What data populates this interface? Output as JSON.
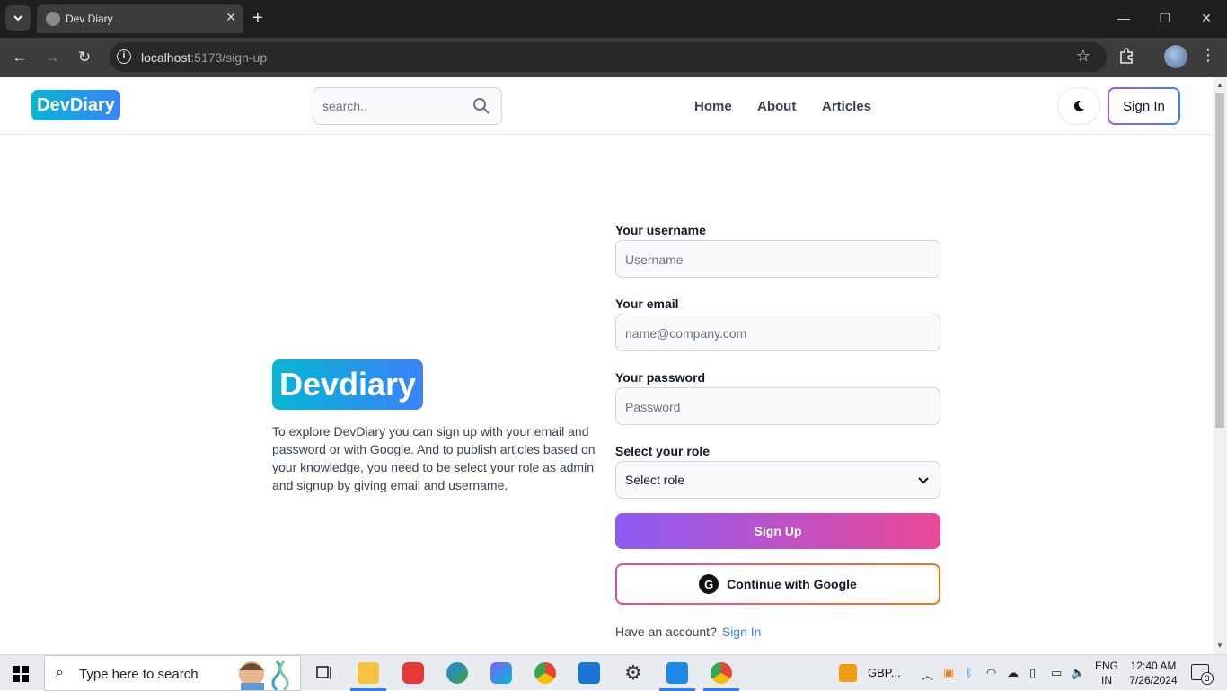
{
  "browser": {
    "tab_title": "Dev Diary",
    "url_host": "localhost",
    "url_path": ":5173/sign-up"
  },
  "header": {
    "logo": "DevDiary",
    "search_placeholder": "search..",
    "nav": [
      "Home",
      "About",
      "Articles"
    ],
    "signin_label": "Sign In"
  },
  "intro": {
    "brand": "Devdiary",
    "text": "To explore DevDiary you can sign up with your email and password or with Google. And to publish articles based on your knowledge, you need to be select your role as admin and signup by giving email and username."
  },
  "form": {
    "username_label": "Your username",
    "username_placeholder": "Username",
    "email_label": "Your email",
    "email_placeholder": "name@company.com",
    "password_label": "Your password",
    "password_placeholder": "Password",
    "role_label": "Select your role",
    "role_value": "Select role",
    "signup_label": "Sign Up",
    "google_label": "Continue with Google",
    "google_icon_letter": "G",
    "have_account": "Have an account?",
    "signin_link": "Sign In"
  },
  "taskbar": {
    "search_text": "Type here to search",
    "tray_text": "GBP...",
    "lang_line1": "ENG",
    "lang_line2": "IN",
    "time": "12:40 AM",
    "date": "7/26/2024",
    "notif_count": "3"
  },
  "colors": {
    "brand_gradient_start": "#06b6d4",
    "brand_gradient_end": "#3b82f6",
    "signup_gradient_start": "#8b5cf6",
    "signup_gradient_end": "#ec4899",
    "link": "#3b82f6"
  }
}
